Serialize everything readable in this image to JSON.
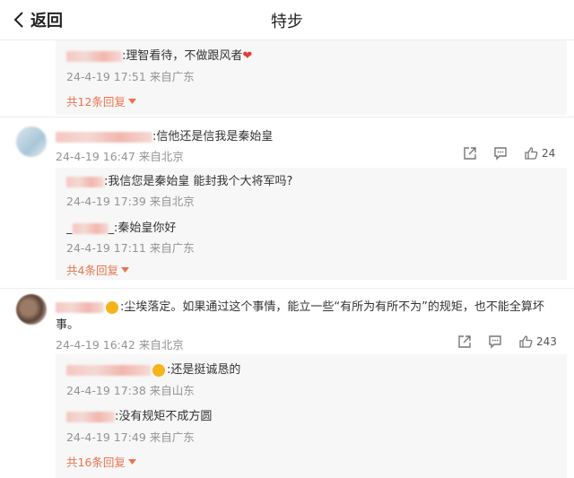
{
  "header": {
    "back_label": "返回",
    "title": "特步"
  },
  "replies1": [
    {
      "text": ":理智看待，不做跟风者",
      "meta": "24-4-19 17:51 来自广东"
    }
  ],
  "more1": "共12条回复",
  "comment1": {
    "text": ":信他还是信我是秦始皇",
    "meta": "24-4-19 16:47 来自北京",
    "like_count": "24",
    "replies": [
      {
        "text": ":我信您是秦始皇 能封我个大将军吗?",
        "meta": "24-4-19 17:39 来自北京"
      },
      {
        "prefix": "_",
        "text": "_:秦始皇你好",
        "meta": "24-4-19 17:11 来自广东"
      }
    ],
    "more": "共4条回复"
  },
  "comment2": {
    "text_line1": ":尘埃落定。如果通过这个事情，能立一些“有所为有所不为”的规矩，也不能全算坏",
    "text_line2": "事。",
    "meta": "24-4-19 16:42 来自北京",
    "like_count": "243",
    "replies": [
      {
        "text": ":还是挺诚恳的",
        "meta": "24-4-19 17:38 来自山东"
      },
      {
        "text": ":没有规矩不成方圆",
        "meta": "24-4-19 17:49 来自广东"
      }
    ],
    "more": "共16条回复"
  },
  "colors": {
    "accent": "#eb7350",
    "meta": "#939393",
    "sub_bg": "#f7f7f7"
  },
  "icons": [
    "back-chevron-icon",
    "share-icon",
    "comment-icon",
    "like-icon",
    "chevron-down-icon"
  ]
}
